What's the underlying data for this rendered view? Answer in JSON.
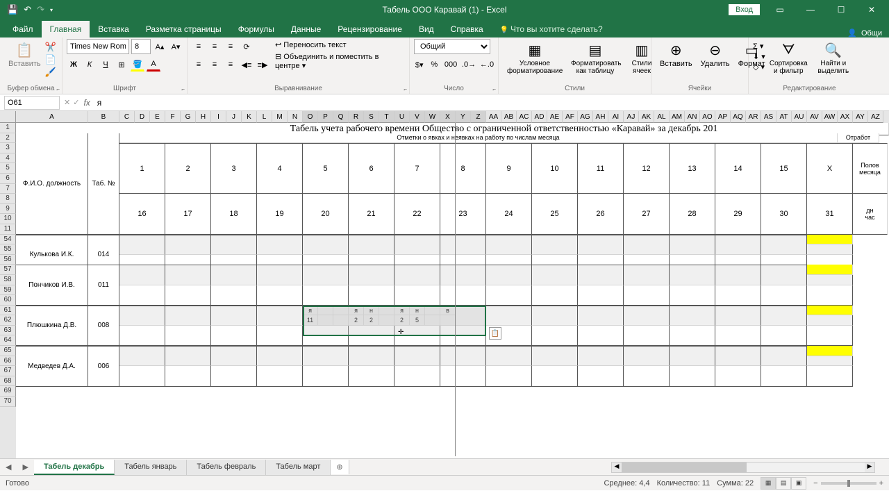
{
  "title": "Табель ООО Каравай (1) - Excel",
  "login": "Вход",
  "tabs": {
    "file": "Файл",
    "home": "Главная",
    "insert": "Вставка",
    "pagelayout": "Разметка страницы",
    "formulas": "Формулы",
    "data": "Данные",
    "review": "Рецензирование",
    "view": "Вид",
    "help": "Справка",
    "tellme": "Что вы хотите сделать?",
    "share": "Общи"
  },
  "ribbon": {
    "paste": "Вставить",
    "clipboard": "Буфер обмена",
    "font_name": "Times New Roman",
    "font_size": "8",
    "font": "Шрифт",
    "wrap": "Переносить текст",
    "merge": "Объединить и поместить в центре",
    "alignment": "Выравнивание",
    "numfmt": "Общий",
    "number": "Число",
    "condfmt": "Условное форматирование",
    "fmt_table": "Форматировать как таблицу",
    "cell_styles": "Стили ячеек",
    "styles": "Стили",
    "insert_c": "Вставить",
    "delete_c": "Удалить",
    "format_c": "Формат",
    "cells": "Ячейки",
    "sort_filter": "Сортировка и фильтр",
    "find_select": "Найти и выделить",
    "editing": "Редактирование"
  },
  "namebox": "O61",
  "formula": "я",
  "columns": [
    "A",
    "B",
    "C",
    "D",
    "E",
    "F",
    "G",
    "H",
    "I",
    "J",
    "K",
    "L",
    "M",
    "N",
    "O",
    "P",
    "Q",
    "R",
    "S",
    "T",
    "U",
    "V",
    "W",
    "X",
    "Y",
    "Z",
    "AA",
    "AB",
    "AC",
    "AD",
    "AE",
    "AF",
    "AG",
    "AH",
    "AI",
    "AJ",
    "AK",
    "AL",
    "AM",
    "AN",
    "AO",
    "AP",
    "AQ",
    "AR",
    "AS",
    "AT",
    "AU",
    "AV",
    "AW",
    "AX",
    "AY",
    "AZ"
  ],
  "col_widths": {
    "A": 104,
    "B": 45
  },
  "col_default": 22,
  "rows": [
    1,
    2,
    3,
    4,
    5,
    6,
    7,
    8,
    9,
    10,
    11,
    54,
    55,
    56,
    57,
    58,
    59,
    60,
    61,
    62,
    63,
    64,
    65,
    66,
    67,
    68,
    69,
    70
  ],
  "heading": "Табель учета рабочего времени Общество с ограниченной ответственностью «Каравай» за декабрь 201",
  "subheading": "Отметки о явках и неявках на работу по числам месяца",
  "otrabot": "Отработ",
  "row_labels": {
    "fio": "Ф.И.О. должность",
    "tabno": "Таб. №",
    "polovina": "Полов месяца",
    "dni_chas": "дн\nчас"
  },
  "day_row1": [
    "1",
    "2",
    "3",
    "4",
    "5",
    "6",
    "7",
    "8",
    "9",
    "10",
    "11",
    "12",
    "13",
    "14",
    "15",
    "X"
  ],
  "day_row2": [
    "16",
    "17",
    "18",
    "19",
    "20",
    "21",
    "22",
    "23",
    "24",
    "25",
    "26",
    "27",
    "28",
    "29",
    "30",
    "31"
  ],
  "employees": [
    {
      "name": "Кулькова И.К.",
      "tabno": "014"
    },
    {
      "name": "Пончиков И.В.",
      "tabno": "011"
    },
    {
      "name": "Плюшкина Д.В.",
      "tabno": "008"
    },
    {
      "name": "Медведев Д.А.",
      "tabno": "006"
    }
  ],
  "data_cells": {
    "r61": [
      "я",
      "",
      "",
      "я",
      "н",
      "",
      "я",
      "н",
      "",
      "в"
    ],
    "r62": [
      "11",
      "",
      "",
      "2",
      "2",
      "",
      "2",
      "5",
      "",
      ""
    ]
  },
  "sheets": [
    "Табель декабрь",
    "Табель январь",
    "Табель февраль",
    "Табель март"
  ],
  "status": {
    "ready": "Готово",
    "avg_label": "Среднее:",
    "avg": "4,4",
    "count_label": "Количество:",
    "count": "11",
    "sum_label": "Сумма:",
    "sum": "22"
  }
}
